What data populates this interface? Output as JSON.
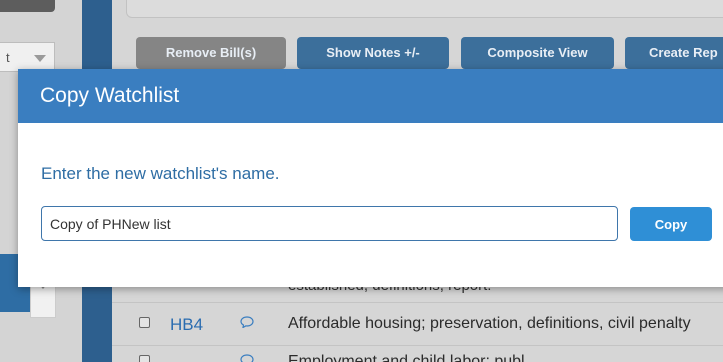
{
  "background": {
    "left_select_text": "t",
    "toolbar": {
      "remove_bills": "Remove Bill(s)",
      "show_notes": "Show Notes +/-",
      "composite_view": "Composite View",
      "create_report": "Create Rep"
    },
    "rows": [
      {
        "bill": "",
        "description": "established, definitions, report."
      },
      {
        "bill": "HB4",
        "description": "Affordable housing; preservation, definitions, civil penalty"
      },
      {
        "bill": "",
        "description": "Employment and child labor; publ..."
      }
    ]
  },
  "modal": {
    "title": "Copy Watchlist",
    "prompt": "Enter the new watchlist's name.",
    "name_value": "Copy of PHNew list",
    "copy_label": "Copy"
  },
  "colors": {
    "header": "#3a7ec0",
    "prompt": "#2e6da4",
    "primary_button": "#2f8fd6",
    "toolbar_button": "#3c6f9b",
    "disabled_button": "#858585",
    "link": "#2a6cb0"
  }
}
